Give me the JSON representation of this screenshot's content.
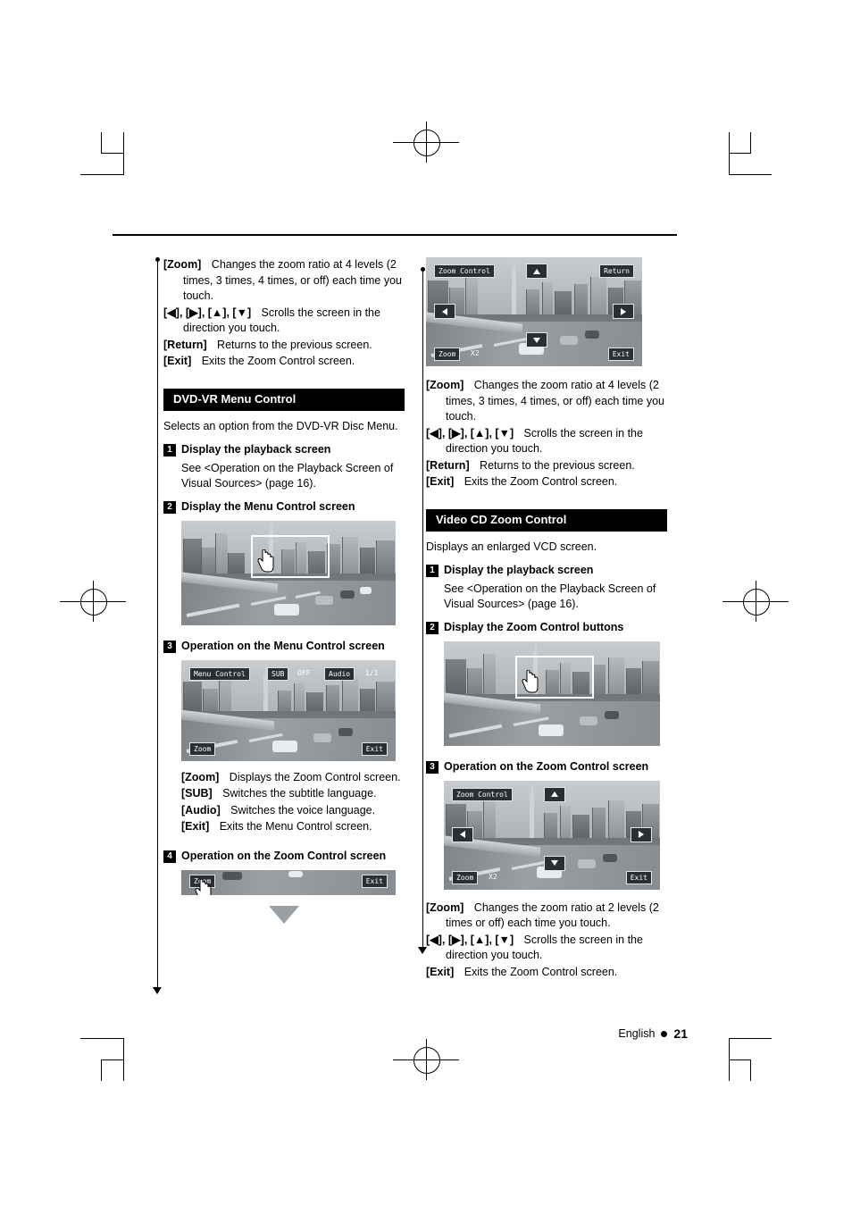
{
  "document": {
    "footer": {
      "language": "English",
      "page": "21"
    }
  },
  "left_column": {
    "top_bullets": [
      {
        "key": "[Zoom]",
        "text": "Changes the zoom ratio at 4 levels (2 times, 3 times, 4 times, or off) each time you touch."
      },
      {
        "key": "[◀], [▶], [▲], [▼]",
        "text": "Scrolls the screen in the direction you touch."
      },
      {
        "key": "[Return]",
        "text": "Returns to the previous screen."
      },
      {
        "key": "[Exit]",
        "text": "Exits the Zoom Control screen."
      }
    ],
    "section": {
      "title": "DVD-VR Menu Control",
      "lead": "Selects an option from the DVD-VR Disc Menu."
    },
    "steps": [
      {
        "num": "1",
        "title": "Display the playback screen",
        "body": "See <Operation on the Playback Screen of Visual Sources> (page 16)."
      },
      {
        "num": "2",
        "title": "Display the Menu Control screen",
        "body": ""
      },
      {
        "num": "3",
        "title": "Operation on the Menu Control screen",
        "body": ""
      },
      {
        "num": "4",
        "title": "Operation on the Zoom Control screen",
        "body": ""
      }
    ],
    "menu_control_bullets": [
      {
        "key": "[Zoom]",
        "text": "Displays the Zoom Control screen."
      },
      {
        "key": "[SUB]",
        "text": "Switches the subtitle language."
      },
      {
        "key": "[Audio]",
        "text": "Switches the voice language."
      },
      {
        "key": "[Exit]",
        "text": "Exits the Menu Control screen."
      }
    ],
    "figures": {
      "menu_control_osd": {
        "title": "Menu Control",
        "sub_label": "SUB",
        "sub_value": "OFF",
        "audio_label": "Audio",
        "audio_value": "1/1",
        "zoom_label": "Zoom",
        "exit_label": "Exit"
      },
      "zoom_strip": {
        "zoom_label": "Zoom",
        "exit_label": "Exit"
      }
    }
  },
  "right_column": {
    "zoom_figure": {
      "title": "Zoom Control",
      "return_label": "Return",
      "zoom_label": "Zoom",
      "zoom_value": "X2",
      "exit_label": "Exit"
    },
    "top_bullets": [
      {
        "key": "[Zoom]",
        "text": "Changes the zoom ratio at 4 levels (2 times, 3 times, 4 times, or off) each time you touch."
      },
      {
        "key": "[◀], [▶], [▲], [▼]",
        "text": "Scrolls the screen in the direction you touch."
      },
      {
        "key": "[Return]",
        "text": "Returns to the previous screen."
      },
      {
        "key": "[Exit]",
        "text": "Exits the Zoom Control screen."
      }
    ],
    "section": {
      "title": "Video CD Zoom Control",
      "lead": "Displays an enlarged VCD screen."
    },
    "steps": [
      {
        "num": "1",
        "title": "Display the playback screen",
        "body": "See <Operation on the Playback Screen of Visual Sources> (page 16)."
      },
      {
        "num": "2",
        "title": "Display the Zoom Control buttons",
        "body": ""
      },
      {
        "num": "3",
        "title": "Operation on the Zoom Control screen",
        "body": ""
      }
    ],
    "bottom_bullets": [
      {
        "key": "[Zoom]",
        "text": "Changes the zoom ratio at 2 levels (2 times or off) each time you touch."
      },
      {
        "key": "[◀], [▶], [▲], [▼]",
        "text": "Scrolls the screen in the direction you touch."
      },
      {
        "key": "[Exit]",
        "text": "Exits the Zoom Control screen."
      }
    ]
  }
}
